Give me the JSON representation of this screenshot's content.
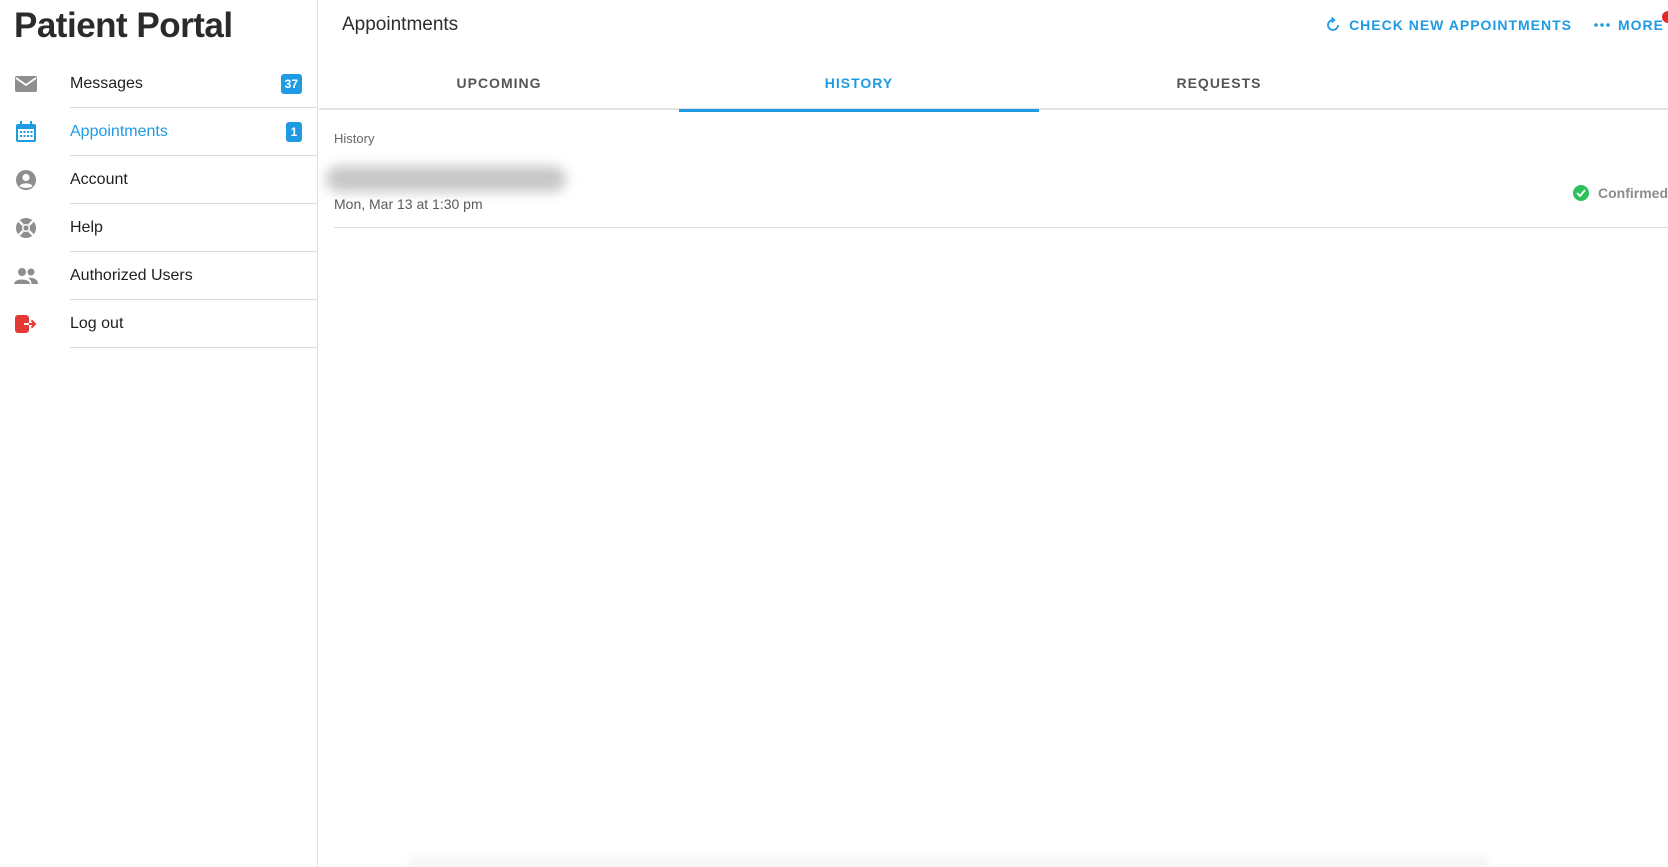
{
  "sidebar": {
    "app_title": "Patient Portal",
    "items": [
      {
        "label": "Messages",
        "icon": "envelope-icon",
        "badge": "37",
        "active": false
      },
      {
        "label": "Appointments",
        "icon": "calendar-icon",
        "badge": "1",
        "active": true
      },
      {
        "label": "Account",
        "icon": "account-circle-icon",
        "active": false
      },
      {
        "label": "Help",
        "icon": "lifebuoy-icon",
        "active": false
      },
      {
        "label": "Authorized Users",
        "icon": "people-icon",
        "active": false
      },
      {
        "label": "Log out",
        "icon": "logout-icon",
        "active": false
      }
    ]
  },
  "header": {
    "title": "Appointments",
    "check_new_label": "CHECK NEW APPOINTMENTS",
    "more_label": "MORE"
  },
  "tabs": [
    {
      "label": "UPCOMING",
      "active": false
    },
    {
      "label": "HISTORY",
      "active": true
    },
    {
      "label": "REQUESTS",
      "active": false
    }
  ],
  "history": {
    "section_label": "History",
    "appointments": [
      {
        "date": "Mon, Mar 13 at 1:30 pm",
        "status": "Confirmed"
      }
    ]
  },
  "colors": {
    "accent": "#1e9be3",
    "confirmed": "#2cc25b",
    "logout": "#e53935",
    "notification_dot": "#e62828"
  }
}
